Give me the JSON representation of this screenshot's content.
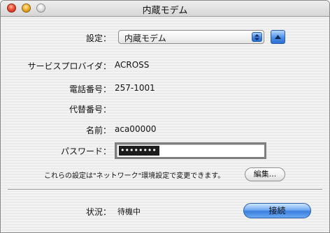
{
  "window": {
    "title": "内蔵モデム"
  },
  "settings": {
    "label": "設定：",
    "selected": "内蔵モデム"
  },
  "isp": {
    "label": "サービスプロバイダ：",
    "value": "ACROSS"
  },
  "phone": {
    "label": "電話番号：",
    "value": "257-1001"
  },
  "alt_phone": {
    "label": "代替番号：",
    "value": ""
  },
  "name": {
    "label": "名前：",
    "value": "aca00000"
  },
  "password": {
    "label": "パスワード：",
    "masked_value": "••••••••"
  },
  "note": {
    "text": "これらの設定は\"ネットワーク\"環境設定で変更できます。",
    "edit_button": "編集..."
  },
  "status": {
    "label": "状況：",
    "value": "待機中"
  },
  "connect_button": "接続",
  "colors": {
    "accent_blue": "#3b7fde",
    "close": "#ee4e34",
    "minimize": "#f2b22e"
  },
  "icons": [
    "close-icon",
    "minimize-icon",
    "zoom-icon",
    "popup-arrows-icon",
    "disclosure-up-icon"
  ]
}
